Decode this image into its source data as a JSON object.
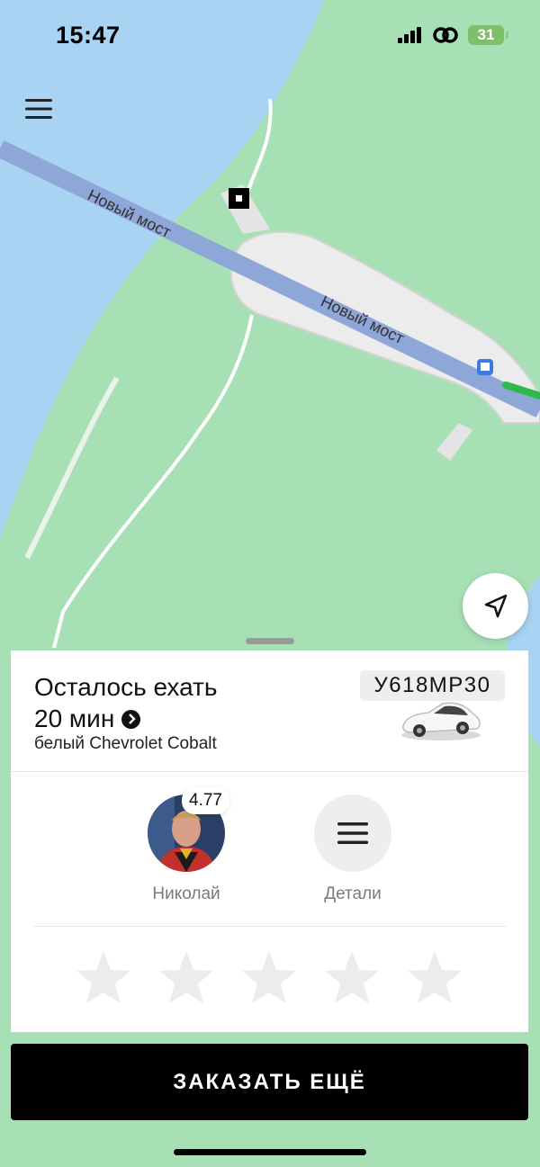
{
  "status_bar": {
    "time": "15:47",
    "battery_level": "31"
  },
  "map": {
    "road_labels": [
      "Новый мост",
      "Новый мост"
    ],
    "colors": {
      "water": "#a9d3f2",
      "land": "#a8e0b6",
      "road": "#8fa7d8",
      "built_area": "#ececec",
      "route": "#2fb94b"
    }
  },
  "trip": {
    "title": "Осталось ехать",
    "eta": "20 мин",
    "car_description": "белый Chevrolet Cobalt",
    "plate": "У618МР30"
  },
  "driver": {
    "name": "Николай",
    "rating": "4.77"
  },
  "details": {
    "label": "Детали"
  },
  "rating_stars": {
    "count": 5,
    "selected": 0
  },
  "actions": {
    "order_again_label": "ЗАКАЗАТЬ ЕЩЁ"
  }
}
